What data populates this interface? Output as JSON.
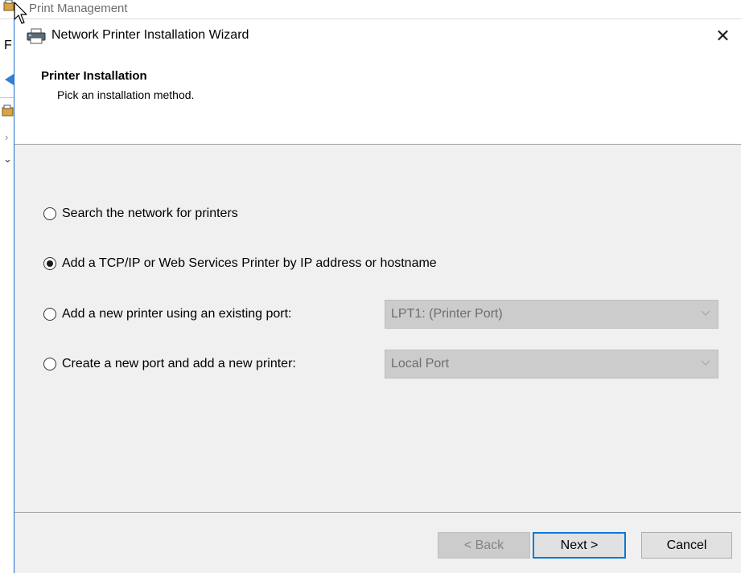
{
  "background_window": {
    "title": "Print Management",
    "menu_letter": "F"
  },
  "dialog": {
    "title": "Network Printer Installation Wizard",
    "close_label": "✕",
    "header": {
      "title": "Printer Installation",
      "subtitle": "Pick an installation method."
    },
    "options": [
      {
        "label": "Search the network for printers",
        "checked": false
      },
      {
        "label": "Add a TCP/IP or Web Services Printer by IP address or hostname",
        "checked": true
      },
      {
        "label": "Add a new printer using an existing port:",
        "checked": false
      },
      {
        "label": "Create a new port and add a new printer:",
        "checked": false
      }
    ],
    "existing_port_select": {
      "value": "LPT1: (Printer Port)",
      "enabled": false
    },
    "new_port_select": {
      "value": "Local Port",
      "enabled": false
    },
    "buttons": {
      "back": "< Back",
      "next": "Next >",
      "cancel": "Cancel"
    }
  },
  "colors": {
    "dialog_bg": "#f0f0f0",
    "accent": "#0078d7",
    "disabled_control": "#cccccc"
  }
}
